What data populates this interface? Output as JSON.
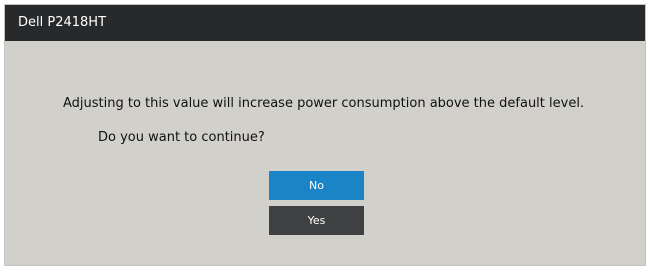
{
  "window": {
    "title": "Dell P2418HT"
  },
  "dialog": {
    "message": "Adjusting to this value will increase power consumption above the default level.",
    "question": "Do you want to continue?",
    "buttons": {
      "no_label": "No",
      "yes_label": "Yes"
    }
  },
  "colors": {
    "title_bar": "#28292b",
    "background": "#d1d0cb",
    "selected_button": "#1b84c7",
    "unselected_button": "#3f4041",
    "text": "#111111"
  }
}
